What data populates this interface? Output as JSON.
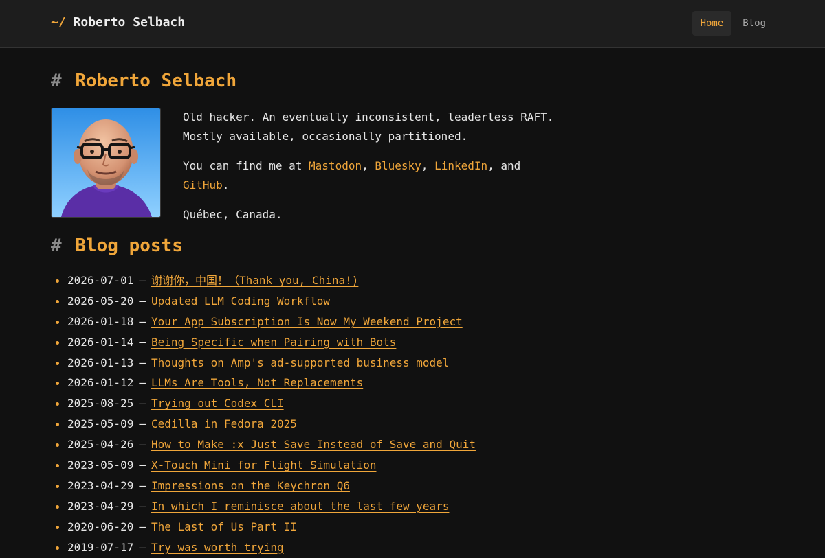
{
  "header": {
    "brand_prefix": "~/",
    "brand_name": "Roberto Selbach",
    "nav": [
      {
        "label": "Home",
        "active": true
      },
      {
        "label": "Blog",
        "active": false
      }
    ]
  },
  "intro": {
    "heading_hash": "#",
    "heading": "Roberto Selbach",
    "avatar_icon": "avatar-portrait",
    "bio_line": "Old hacker. An eventually inconsistent, leaderless RAFT. Mostly available, occasionally partitioned.",
    "find_prefix": "You can find me at",
    "links": [
      "Mastodon",
      "Bluesky",
      "LinkedIn",
      "GitHub"
    ],
    "find_and": ", and",
    "location": "Québec, Canada."
  },
  "posts": {
    "heading_hash": "#",
    "heading": "Blog posts",
    "separator": "—",
    "items": [
      {
        "date": "2026-07-01",
        "title": "谢谢你，中国！（Thank you, China!)"
      },
      {
        "date": "2026-05-20",
        "title": "Updated LLM Coding Workflow"
      },
      {
        "date": "2026-01-18",
        "title": "Your App Subscription Is Now My Weekend Project"
      },
      {
        "date": "2026-01-14",
        "title": "Being Specific when Pairing with Bots"
      },
      {
        "date": "2026-01-13",
        "title": "Thoughts on Amp's ad-supported business model"
      },
      {
        "date": "2026-01-12",
        "title": "LLMs Are Tools, Not Replacements"
      },
      {
        "date": "2025-08-25",
        "title": "Trying out Codex CLI"
      },
      {
        "date": "2025-05-09",
        "title": "Cedilla in Fedora 2025"
      },
      {
        "date": "2025-04-26",
        "title": "How to Make :x Just Save Instead of Save and Quit"
      },
      {
        "date": "2023-05-09",
        "title": "X-Touch Mini for Flight Simulation"
      },
      {
        "date": "2023-04-29",
        "title": "Impressions on the Keychron Q6"
      },
      {
        "date": "2023-04-29",
        "title": "In which I reminisce about the last few years"
      },
      {
        "date": "2020-06-20",
        "title": "The Last of Us Part II"
      },
      {
        "date": "2019-07-17",
        "title": "Try was worth trying"
      }
    ]
  },
  "colors": {
    "accent": "#f0a63a",
    "background": "#111111",
    "header_bg": "#1d1d1d",
    "text": "#e6e6e6",
    "muted": "#8a8a8a"
  }
}
